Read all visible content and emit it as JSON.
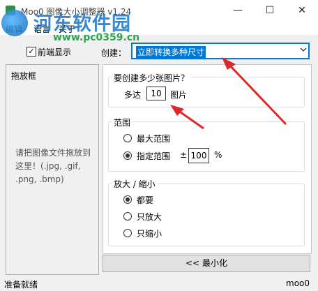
{
  "window": {
    "title": "Moo0 图像大小调整器 v1.24",
    "min": "—",
    "max": "☐",
    "close": "✕"
  },
  "menu": {
    "items": [
      "编辑",
      "语言",
      "关于"
    ]
  },
  "watermark": {
    "text": "河东软件园",
    "url": "www.pc0359.cn"
  },
  "options": {
    "front_label": "前端显示",
    "front_checked": true,
    "create_label": "创建：",
    "create_value": "立即转换多种尺寸"
  },
  "dropzone": {
    "title": "拖放框",
    "hint": "请把图像文件拖放到这里！(.jpg, .gif, .png, .bmp)"
  },
  "count": {
    "question": "要创建多少张图片？",
    "prefix": "多达",
    "value": "10",
    "suffix": "图片"
  },
  "range": {
    "legend": "范围",
    "max_option": "最大范围",
    "custom_option": "指定范围",
    "plusminus": "±",
    "value": "100",
    "unit": "%"
  },
  "scale": {
    "legend": "放大 / 缩小",
    "both": "都要",
    "enlarge_only": "只放大",
    "shrink_only": "只缩小"
  },
  "actions": {
    "minimize": "<< 最小化"
  },
  "status": {
    "text": "准备就绪",
    "brand": "moo0"
  },
  "colors": {
    "accent": "#0078d7",
    "arrow": "#e0282a"
  }
}
